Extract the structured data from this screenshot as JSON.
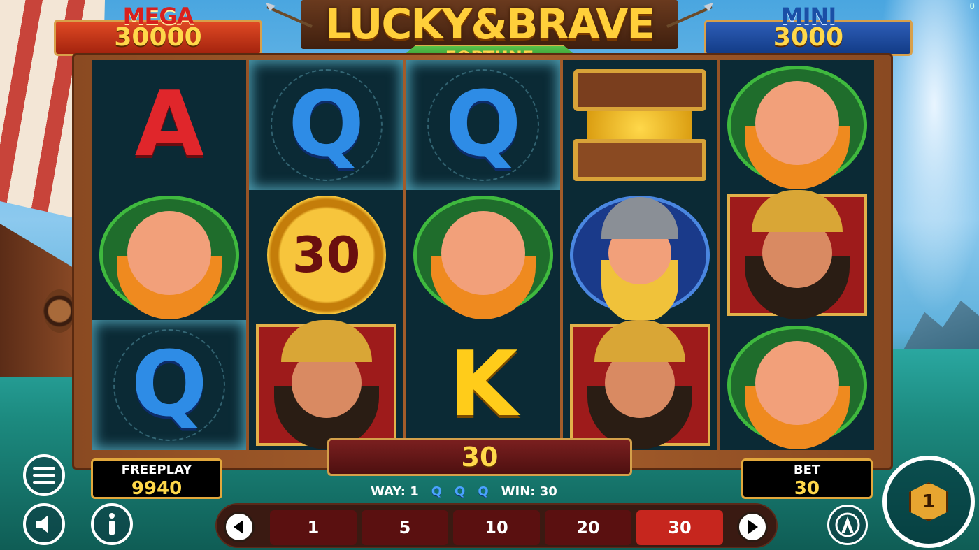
{
  "jackpots": {
    "mega": {
      "name": "MEGA",
      "value": "30000"
    },
    "mini": {
      "name": "MINI",
      "value": "3000"
    }
  },
  "logo": {
    "title": "LUCKY&BRAVE",
    "subtitle": "FORTUNE"
  },
  "corner_counter": "0",
  "reels": [
    [
      "A",
      "red-bearded-viking",
      "Q"
    ],
    [
      "Q",
      "coin-30",
      "dark-bearded-viking"
    ],
    [
      "Q",
      "red-bearded-viking",
      "K"
    ],
    [
      "treasure-chest",
      "helmet-viking",
      "dark-bearded-viking"
    ],
    [
      "red-bearded-viking",
      "dark-bearded-viking",
      "red-bearded-viking"
    ]
  ],
  "coin_value": "30",
  "win_display": "30",
  "freeplay": {
    "label": "FREEPLAY",
    "value": "9940"
  },
  "bet": {
    "label": "BET",
    "value": "30"
  },
  "way_info": {
    "way": "WAY: 1",
    "symbols": [
      "Q",
      "Q",
      "Q"
    ],
    "win": "WIN: 30"
  },
  "bet_options": [
    "1",
    "5",
    "10",
    "20",
    "30"
  ],
  "selected_bet": "30",
  "spin_counter": "1",
  "icons": {
    "menu": "hamburger-menu-icon",
    "sound": "speaker-icon",
    "info": "info-icon",
    "prev": "chevron-left-icon",
    "next": "chevron-right-icon",
    "autoplay": "autoplay-icon",
    "spin": "spin-icon"
  },
  "colors": {
    "gold": "#ffd84a",
    "selected_bet": "#c6261e",
    "frame": "#a8602c"
  }
}
